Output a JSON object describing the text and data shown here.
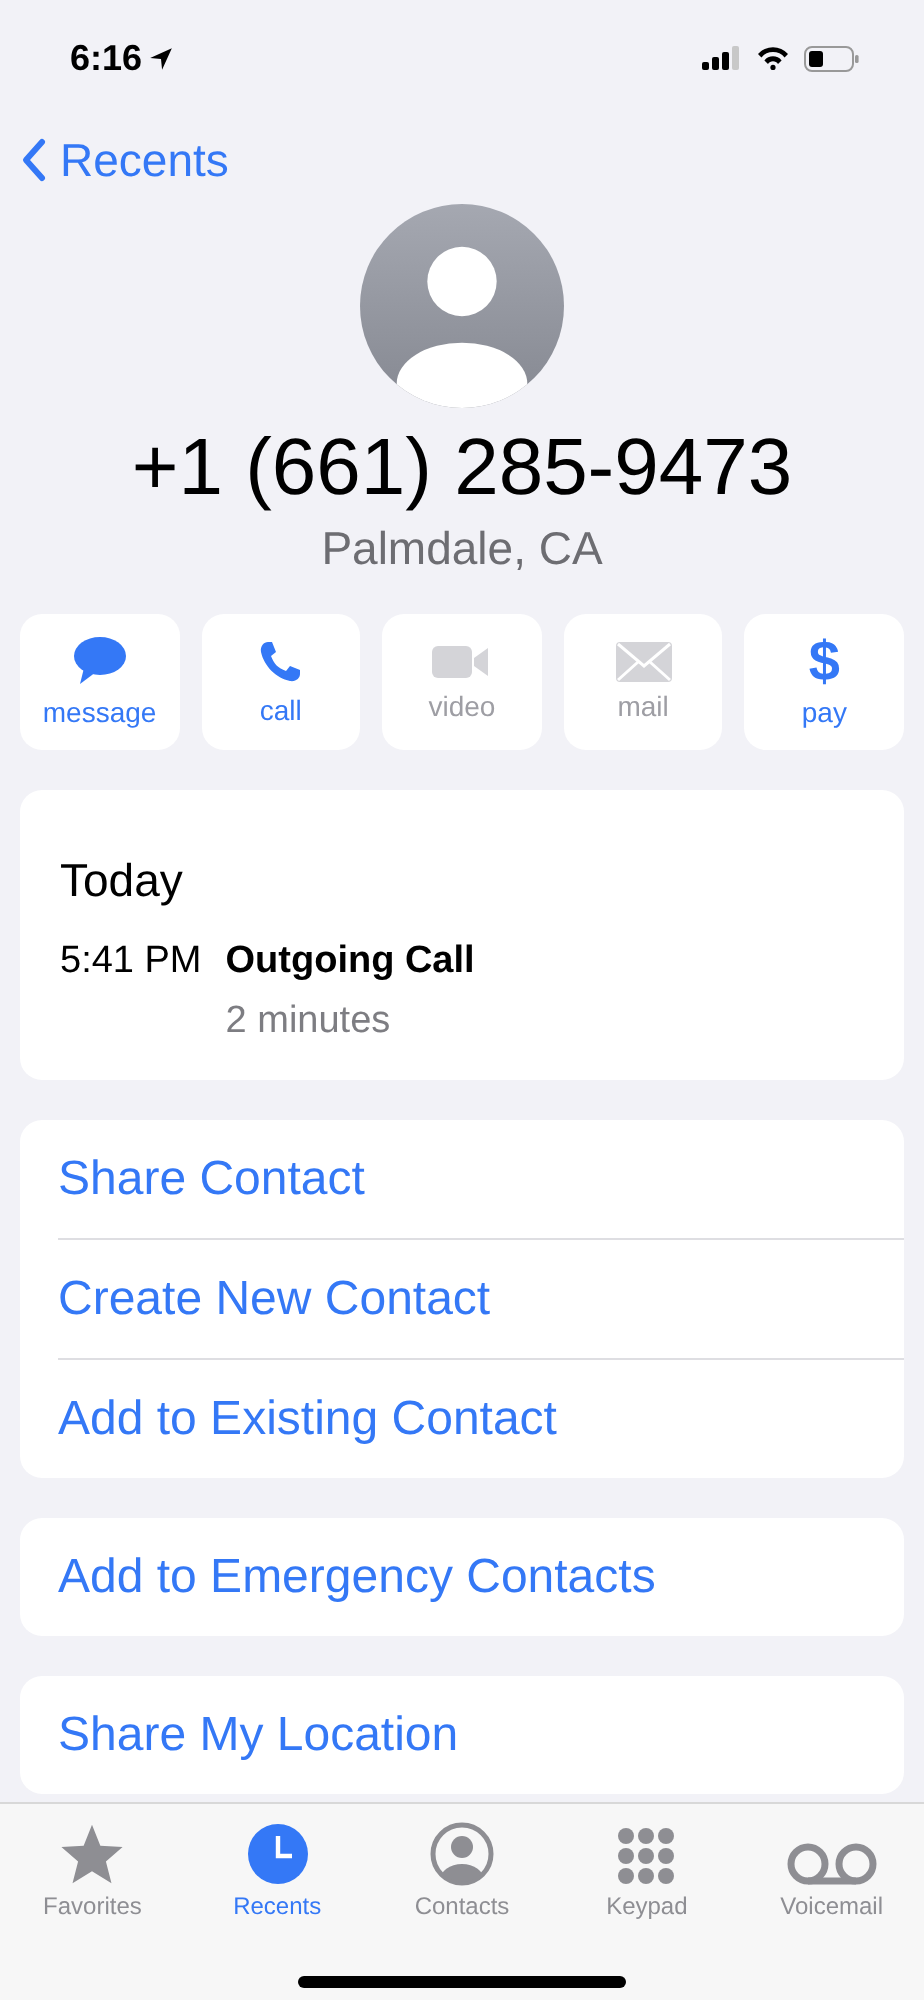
{
  "status_bar": {
    "time": "6:16"
  },
  "nav": {
    "back_label": "Recents"
  },
  "contact": {
    "number": "+1 (661) 285-9473",
    "location": "Palmdale, CA"
  },
  "actions": [
    {
      "kind": "message",
      "label": "message",
      "disabled": false
    },
    {
      "kind": "call",
      "label": "call",
      "disabled": false
    },
    {
      "kind": "video",
      "label": "video",
      "disabled": true
    },
    {
      "kind": "mail",
      "label": "mail",
      "disabled": true
    },
    {
      "kind": "pay",
      "label": "pay",
      "glyph": "$",
      "disabled": false
    }
  ],
  "history": {
    "day": "Today",
    "entries": [
      {
        "time": "5:41 PM",
        "type": "Outgoing Call",
        "duration": "2 minutes"
      }
    ]
  },
  "option_groups": [
    [
      "Share Contact",
      "Create New Contact",
      "Add to Existing Contact"
    ],
    [
      "Add to Emergency Contacts"
    ],
    [
      "Share My Location"
    ]
  ],
  "tab_bar": [
    {
      "kind": "favorites",
      "label": "Favorites",
      "selected": false
    },
    {
      "kind": "recents",
      "label": "Recents",
      "selected": true
    },
    {
      "kind": "contacts",
      "label": "Contacts",
      "selected": false
    },
    {
      "kind": "keypad",
      "label": "Keypad",
      "selected": false
    },
    {
      "kind": "voicemail",
      "label": "Voicemail",
      "selected": false
    }
  ]
}
